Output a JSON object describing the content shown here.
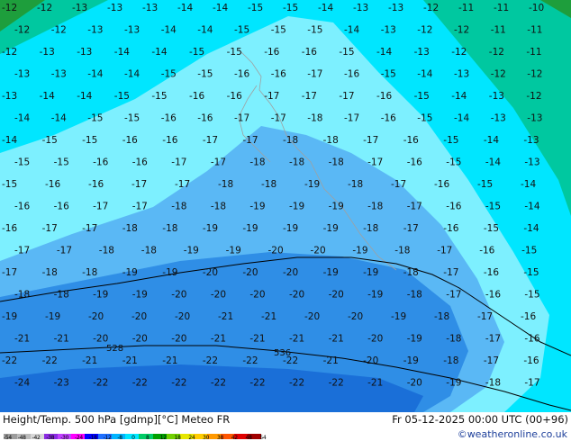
{
  "title_left": "Height/Temp. 500 hPa [gdmp][°C] Meteo FR",
  "title_right": "Fr 05-12-2025 00:00 UTC (00+96)",
  "copyright": "©weatheronline.co.uk",
  "legend": {
    "ticks": [
      "-54",
      "-48",
      "-42",
      "-38",
      "-30",
      "-24",
      "-18",
      "-12",
      "-8",
      "0",
      "8",
      "12",
      "18",
      "24",
      "30",
      "38",
      "42",
      "48",
      "54"
    ],
    "colors": [
      "#9c9c9c",
      "#bbbbbb",
      "#d7d7d7",
      "#8a2be2",
      "#c040ff",
      "#ff00ff",
      "#0000ff",
      "#1e6fff",
      "#00b4ff",
      "#00e6ff",
      "#00cc66",
      "#00a000",
      "#70d000",
      "#e6e600",
      "#ffcc00",
      "#ff9900",
      "#ff5500",
      "#e00000",
      "#a00000"
    ]
  },
  "contours": [
    {
      "label": "528"
    },
    {
      "label": "536"
    }
  ],
  "temperature_labels": [
    {
      "row": 1,
      "values": [
        "-12",
        "-12",
        "-13",
        "-13",
        "-13",
        "-14",
        "-14",
        "-15",
        "-15",
        "-14",
        "-13",
        "-13",
        "-12",
        "-11",
        "-11",
        "-10"
      ]
    },
    {
      "row": 2,
      "values": [
        "-12",
        "-12",
        "-13",
        "-13",
        "-14",
        "-14",
        "-15",
        "-15",
        "-15",
        "-14",
        "-13",
        "-12",
        "-12",
        "-11",
        "-11"
      ]
    },
    {
      "row": 3,
      "values": [
        "-12",
        "-13",
        "-13",
        "-14",
        "-14",
        "-15",
        "-15",
        "-16",
        "-16",
        "-15",
        "-14",
        "-13",
        "-12",
        "-12",
        "-11"
      ]
    },
    {
      "row": 4,
      "values": [
        "-13",
        "-13",
        "-14",
        "-14",
        "-15",
        "-15",
        "-16",
        "-16",
        "-17",
        "-16",
        "-15",
        "-14",
        "-13",
        "-12",
        "-12"
      ]
    },
    {
      "row": 5,
      "values": [
        "-13",
        "-14",
        "-14",
        "-15",
        "-15",
        "-16",
        "-16",
        "-17",
        "-17",
        "-17",
        "-16",
        "-15",
        "-14",
        "-13",
        "-12"
      ]
    },
    {
      "row": 6,
      "values": [
        "-14",
        "-14",
        "-15",
        "-15",
        "-16",
        "-16",
        "-17",
        "-17",
        "-18",
        "-17",
        "-16",
        "-15",
        "-14",
        "-13",
        "-13"
      ]
    },
    {
      "row": 7,
      "values": [
        "-14",
        "-15",
        "-15",
        "-16",
        "-16",
        "-17",
        "-17",
        "-18",
        "-18",
        "-17",
        "-16",
        "-15",
        "-14",
        "-13"
      ]
    },
    {
      "row": 8,
      "values": [
        "-15",
        "-15",
        "-16",
        "-16",
        "-17",
        "-17",
        "-18",
        "-18",
        "-18",
        "-17",
        "-16",
        "-15",
        "-14",
        "-13"
      ]
    },
    {
      "row": 9,
      "values": [
        "-15",
        "-16",
        "-16",
        "-17",
        "-17",
        "-18",
        "-18",
        "-19",
        "-18",
        "-17",
        "-16",
        "-15",
        "-14"
      ]
    },
    {
      "row": 10,
      "values": [
        "-16",
        "-16",
        "-17",
        "-17",
        "-18",
        "-18",
        "-19",
        "-19",
        "-19",
        "-18",
        "-17",
        "-16",
        "-15",
        "-14"
      ]
    },
    {
      "row": 11,
      "values": [
        "-16",
        "-17",
        "-17",
        "-18",
        "-18",
        "-19",
        "-19",
        "-19",
        "-19",
        "-18",
        "-17",
        "-16",
        "-15",
        "-14"
      ]
    },
    {
      "row": 12,
      "values": [
        "-17",
        "-17",
        "-18",
        "-18",
        "-19",
        "-19",
        "-20",
        "-20",
        "-19",
        "-18",
        "-17",
        "-16",
        "-15"
      ]
    },
    {
      "row": 13,
      "values": [
        "-17",
        "-18",
        "-18",
        "-19",
        "-19",
        "-20",
        "-20",
        "-20",
        "-19",
        "-19",
        "-18",
        "-17",
        "-16",
        "-15"
      ]
    },
    {
      "row": 14,
      "values": [
        "-18",
        "-18",
        "-19",
        "-19",
        "-20",
        "-20",
        "-20",
        "-20",
        "-20",
        "-19",
        "-18",
        "-17",
        "-16",
        "-15"
      ]
    },
    {
      "row": 15,
      "values": [
        "-19",
        "-19",
        "-20",
        "-20",
        "-20",
        "-21",
        "-21",
        "-20",
        "-20",
        "-19",
        "-18",
        "-17",
        "-16"
      ]
    },
    {
      "row": 16,
      "values": [
        "-21",
        "-21",
        "-20",
        "-20",
        "-20",
        "-21",
        "-21",
        "-21",
        "-21",
        "-20",
        "-19",
        "-18",
        "-17",
        "-16"
      ]
    },
    {
      "row": 17,
      "values": [
        "-22",
        "-22",
        "-21",
        "-21",
        "-21",
        "-22",
        "-22",
        "-22",
        "-21",
        "-20",
        "-19",
        "-18",
        "-17",
        "-16"
      ]
    },
    {
      "row": 18,
      "values": [
        "-24",
        "-23",
        "-22",
        "-22",
        "-22",
        "-22",
        "-22",
        "-22",
        "-22",
        "-21",
        "-20",
        "-19",
        "-18",
        "-17"
      ]
    }
  ]
}
